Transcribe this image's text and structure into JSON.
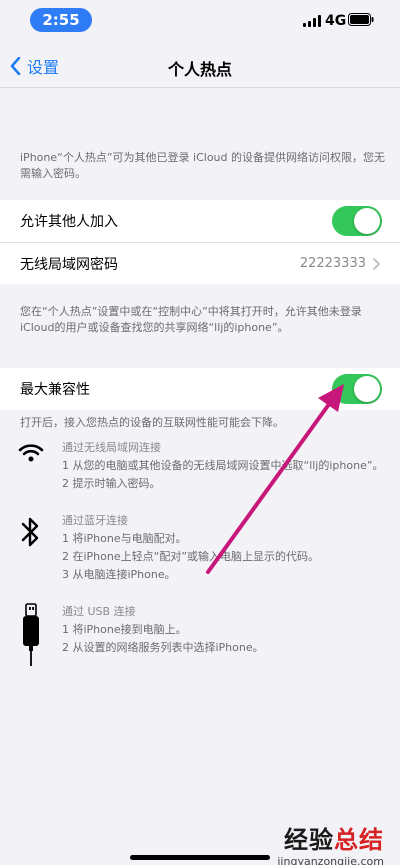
{
  "status_bar": {
    "time": "2:55",
    "network": "4G"
  },
  "nav": {
    "back_label": "设置",
    "title": "个人热点"
  },
  "intro_note": "iPhone“个人热点”可为其他已登录 iCloud 的设备提供网络访问权限，您无需输入密码。",
  "settings": {
    "allow_others_label": "允许其他人加入",
    "allow_others_on": true,
    "wifi_password_label": "无线局域网密码",
    "wifi_password_value": "22223333"
  },
  "control_note": "您在“个人热点”设置中或在“控制中心”中将其打开时，允许其他未登录 iCloud的用户或设备查找您的共享网络“llj的iphone”。",
  "compat": {
    "label": "最大兼容性",
    "on": true,
    "note": "打开后，接入您热点的设备的互联网性能可能会下降。"
  },
  "connections": [
    {
      "icon": "wifi-icon",
      "title": "通过无线局域网连接",
      "steps": [
        "1 从您的电脑或其他设备的无线局域网设置中选取“llj的iphone”。",
        "2 提示时输入密码。"
      ]
    },
    {
      "icon": "bluetooth-icon",
      "title": "通过蓝牙连接",
      "steps": [
        "1 将iPhone与电脑配对。",
        "2 在iPhone上轻点“配对”或输入电脑上显示的代码。",
        "3 从电脑连接iPhone。"
      ]
    },
    {
      "icon": "usb-cable-icon",
      "title": "通过 USB 连接",
      "steps": [
        "1 将iPhone接到电脑上。",
        "2 从设置的网络服务列表中选择iPhone。"
      ]
    }
  ],
  "watermark": {
    "line1_a": "经验",
    "line1_b": "总结",
    "line2": "jingyanzongjie.com"
  },
  "colors": {
    "toggle_on": "#34c759",
    "accent": "#1e7cf2",
    "arrow": "#c8177a"
  }
}
